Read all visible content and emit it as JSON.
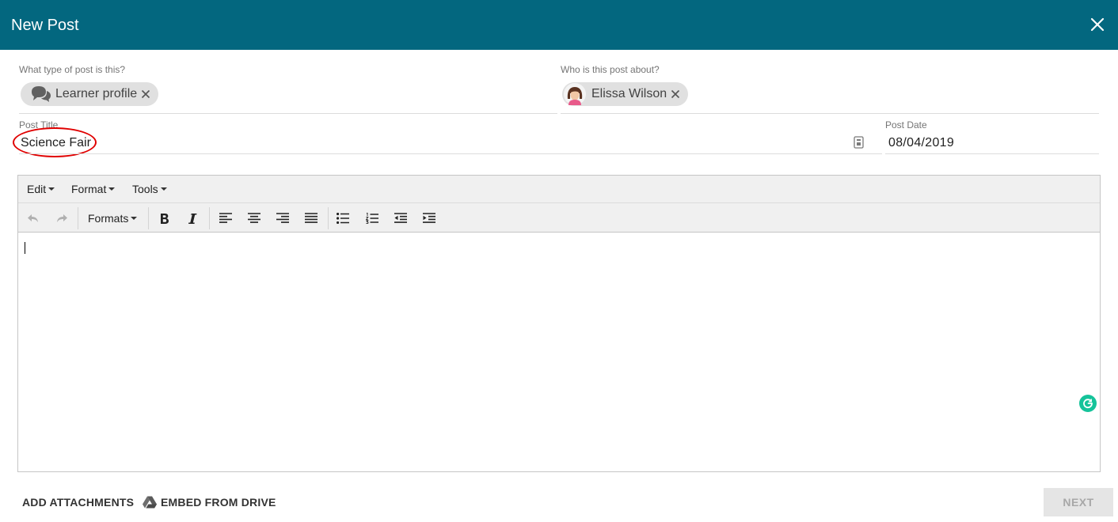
{
  "header": {
    "title": "New Post",
    "close_icon": "close-icon",
    "background": "#03677f"
  },
  "post_type": {
    "label": "What type of post is this?",
    "chip": {
      "text": "Learner profile",
      "icon": "speech-bubbles-icon",
      "remove_icon": "close-icon"
    }
  },
  "post_about": {
    "label": "Who is this post about?",
    "chip": {
      "text": "Elissa Wilson",
      "icon": "avatar",
      "remove_icon": "close-icon"
    }
  },
  "post_title": {
    "label": "Post Title",
    "value": "Science Fair",
    "highlight_color": "#e00000"
  },
  "post_date": {
    "label": "Post Date",
    "value": "08/04/2019"
  },
  "editor": {
    "menus": [
      "Edit",
      "Format",
      "Tools"
    ],
    "formats_label": "Formats",
    "toolbar_icons": [
      "undo-icon",
      "redo-icon",
      "bold-icon",
      "italic-icon",
      "align-left-icon",
      "align-center-icon",
      "align-right-icon",
      "align-justify-icon",
      "bullet-list-icon",
      "numbered-list-icon",
      "outdent-icon",
      "indent-icon"
    ],
    "content": ""
  },
  "footer": {
    "add_attachments": "ADD ATTACHMENTS",
    "embed_drive": "EMBED FROM DRIVE",
    "next": "NEXT"
  }
}
